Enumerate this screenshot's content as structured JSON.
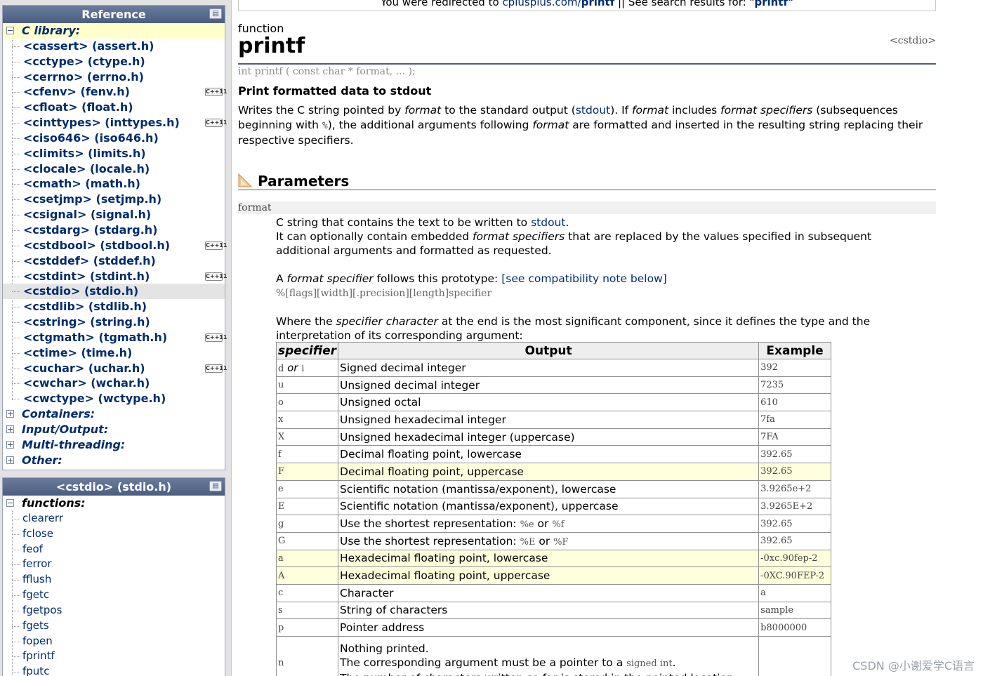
{
  "sidebar": {
    "reference_title": "Reference",
    "categories_top": {
      "label": "C library:",
      "toggle": "−"
    },
    "headers": [
      {
        "label": "<cassert> (assert.h)",
        "cpp11": false
      },
      {
        "label": "<cctype> (ctype.h)",
        "cpp11": false
      },
      {
        "label": "<cerrno> (errno.h)",
        "cpp11": false
      },
      {
        "label": "<cfenv> (fenv.h)",
        "cpp11": true
      },
      {
        "label": "<cfloat> (float.h)",
        "cpp11": false
      },
      {
        "label": "<cinttypes> (inttypes.h)",
        "cpp11": true
      },
      {
        "label": "<ciso646> (iso646.h)",
        "cpp11": false
      },
      {
        "label": "<climits> (limits.h)",
        "cpp11": false
      },
      {
        "label": "<clocale> (locale.h)",
        "cpp11": false
      },
      {
        "label": "<cmath> (math.h)",
        "cpp11": false
      },
      {
        "label": "<csetjmp> (setjmp.h)",
        "cpp11": false
      },
      {
        "label": "<csignal> (signal.h)",
        "cpp11": false
      },
      {
        "label": "<cstdarg> (stdarg.h)",
        "cpp11": false
      },
      {
        "label": "<cstdbool> (stdbool.h)",
        "cpp11": true
      },
      {
        "label": "<cstddef> (stddef.h)",
        "cpp11": false
      },
      {
        "label": "<cstdint> (stdint.h)",
        "cpp11": true
      },
      {
        "label": "<cstdio> (stdio.h)",
        "cpp11": false,
        "selected": true
      },
      {
        "label": "<cstdlib> (stdlib.h)",
        "cpp11": false
      },
      {
        "label": "<cstring> (string.h)",
        "cpp11": false
      },
      {
        "label": "<ctgmath> (tgmath.h)",
        "cpp11": true
      },
      {
        "label": "<ctime> (time.h)",
        "cpp11": false
      },
      {
        "label": "<cuchar> (uchar.h)",
        "cpp11": true
      },
      {
        "label": "<cwchar> (wchar.h)",
        "cpp11": false
      },
      {
        "label": "<cwctype> (wctype.h)",
        "cpp11": false
      }
    ],
    "categories_bottom": [
      {
        "label": "Containers:",
        "toggle": "+"
      },
      {
        "label": "Input/Output:",
        "toggle": "+"
      },
      {
        "label": "Multi-threading:",
        "toggle": "+"
      },
      {
        "label": "Other:",
        "toggle": "+"
      }
    ],
    "cpp11_badge": "C++11",
    "header_panel_title": "<cstdio> (stdio.h)",
    "functions_label": "functions:",
    "functions_toggle": "−",
    "functions": [
      "clearerr",
      "fclose",
      "feof",
      "ferror",
      "fflush",
      "fgetc",
      "fgetpos",
      "fgets",
      "fopen",
      "fprintf",
      "fputc"
    ]
  },
  "redirect": {
    "prefix": "You were redirected to",
    "site": "cplusplus.com/",
    "site_bold": "printf",
    "sep": " || ",
    "search_prefix": "See search results for: \"",
    "search_term": "printf",
    "search_suffix": "\""
  },
  "page": {
    "kind": "function",
    "title": "printf",
    "header": "<cstdio>",
    "prototype": "int printf ( const char * format, ... );",
    "short_desc": "Print formatted data to stdout",
    "desc": {
      "p1": "Writes the C string pointed by ",
      "p1_em": "format",
      "p2": " to the standard output (",
      "p2_link": "stdout",
      "p3": "). If ",
      "p3_em": "format",
      "p4": " includes ",
      "p4_em": "format specifiers",
      "p5": " (subsequences beginning with ",
      "p5_code": "%",
      "p6": "), the additional arguments following ",
      "p6_em": "format",
      "p7": " are formatted and inserted in the resulting string replacing their respective specifiers."
    }
  },
  "params": {
    "section_title": "Parameters",
    "name": "format",
    "line1_a": "C string that contains the text to be written to ",
    "line1_link": "stdout",
    "line1_b": ".",
    "line2_a": "It can optionally contain embedded ",
    "line2_em": "format specifiers",
    "line2_b": " that are replaced by the values specified in subsequent additional arguments and formatted as requested.",
    "proto_a": "A ",
    "proto_em": "format specifier",
    "proto_b": " follows this prototype: ",
    "proto_link": "[see compatibility note below]",
    "proto_line": "%[flags][width][.precision][length]specifier",
    "where_a": "Where the ",
    "where_em": "specifier character",
    "where_b": " at the end is the most significant component, since it defines the type and the interpretation of its corresponding argument:"
  },
  "table": {
    "headers": {
      "spec": "specifier",
      "output": "Output",
      "example": "Example"
    },
    "rows": [
      {
        "spec": "d",
        "spec_or": " or ",
        "spec2": "i",
        "output": "Signed decimal integer",
        "example": "392"
      },
      {
        "spec": "u",
        "output": "Unsigned decimal integer",
        "example": "7235"
      },
      {
        "spec": "o",
        "output": "Unsigned octal",
        "example": "610"
      },
      {
        "spec": "x",
        "output": "Unsigned hexadecimal integer",
        "example": "7fa"
      },
      {
        "spec": "X",
        "output": "Unsigned hexadecimal integer (uppercase)",
        "example": "7FA"
      },
      {
        "spec": "f",
        "output": "Decimal floating point, lowercase",
        "example": "392.65"
      },
      {
        "spec": "F",
        "output": "Decimal floating point, uppercase",
        "example": "392.65",
        "hl": true
      },
      {
        "spec": "e",
        "output": "Scientific notation (mantissa/exponent), lowercase",
        "example": "3.9265e+2"
      },
      {
        "spec": "E",
        "output": "Scientific notation (mantissa/exponent), uppercase",
        "example": "3.9265E+2"
      },
      {
        "spec": "g",
        "output": "Use the shortest representation: ",
        "out_c1": "%e",
        "out_or": " or ",
        "out_c2": "%f",
        "example": "392.65"
      },
      {
        "spec": "G",
        "output": "Use the shortest representation: ",
        "out_c1": "%E",
        "out_or": " or ",
        "out_c2": "%F",
        "example": "392.65"
      },
      {
        "spec": "a",
        "output": "Hexadecimal floating point, lowercase",
        "example": "-0xc.90fep-2",
        "hl": true
      },
      {
        "spec": "A",
        "output": "Hexadecimal floating point, uppercase",
        "example": "-0XC.90FEP-2",
        "hl": true
      },
      {
        "spec": "c",
        "output": "Character",
        "example": "a"
      },
      {
        "spec": "s",
        "output": "String of characters",
        "example": "sample"
      },
      {
        "spec": "p",
        "output": "Pointer address",
        "example": "b8000000"
      }
    ],
    "last_row": {
      "spec": "n",
      "line1": "Nothing printed.",
      "line2_a": "The corresponding argument must be a pointer to a ",
      "line2_code": "signed int",
      "line2_b": ".",
      "line3": "The number of characters written so far is stored in the pointed location."
    }
  },
  "watermark": "CSDN @小谢爱学C语言"
}
